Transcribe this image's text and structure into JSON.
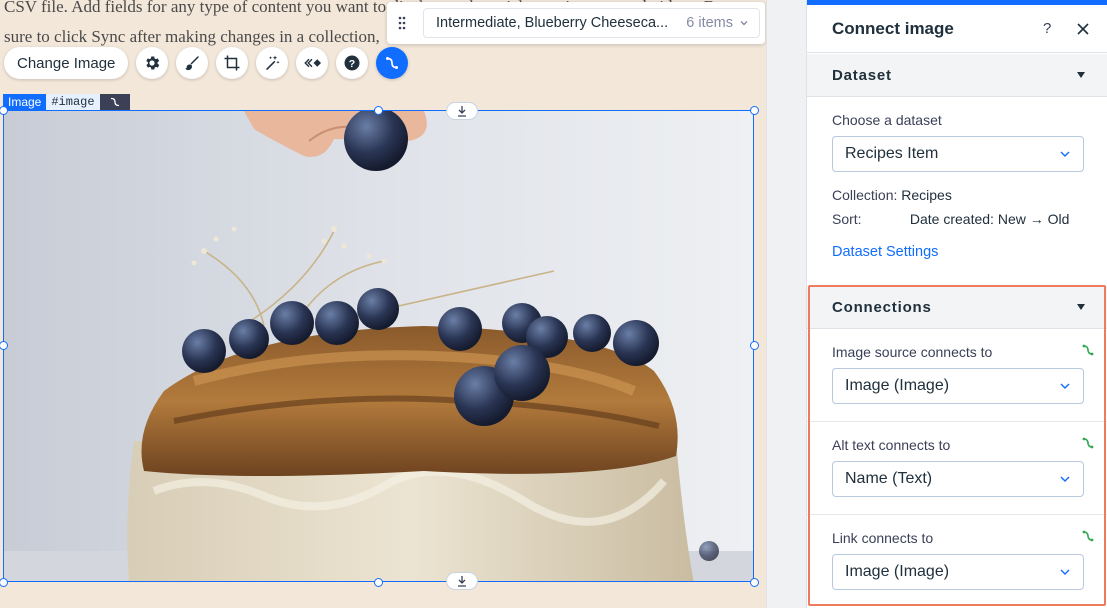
{
  "canvas": {
    "background_text_line1": "CSV file. Add fields for any type of content you want to display, such as rich text, images, and videos. Be",
    "background_text_line2": "sure to click Sync after making changes in a collection, ",
    "selection_tag": {
      "type": "Image",
      "id": "#image"
    }
  },
  "toolbar": {
    "change_image_label": "Change Image",
    "icons": [
      "gear-icon",
      "brush-icon",
      "crop-icon",
      "magic-wand-icon",
      "animation-icon",
      "help-icon",
      "connect-data-icon"
    ]
  },
  "dataset_nav": {
    "item_name": "Intermediate, Blueberry Cheeseca...",
    "item_count": "6 items"
  },
  "panel": {
    "title": "Connect image",
    "help_label": "?",
    "dataset_section": {
      "title": "Dataset",
      "choose_label": "Choose a dataset",
      "selected_dataset": "Recipes Item",
      "collection_key": "Collection:",
      "collection_value": "Recipes",
      "sort_key": "Sort:",
      "sort_value": "Date created: New → Old",
      "settings_link": "Dataset Settings"
    },
    "connections_section": {
      "title": "Connections",
      "fields": [
        {
          "label": "Image source connects to",
          "value": "Image (Image)"
        },
        {
          "label": "Alt text connects to",
          "value": "Name (Text)"
        },
        {
          "label": "Link connects to",
          "value": "Image (Image)"
        }
      ]
    }
  },
  "colors": {
    "accent": "#116dff",
    "highlight_border": "#ef7a5e",
    "canvas_bg": "#f3e7da",
    "connected_icon": "#2fa84f"
  }
}
